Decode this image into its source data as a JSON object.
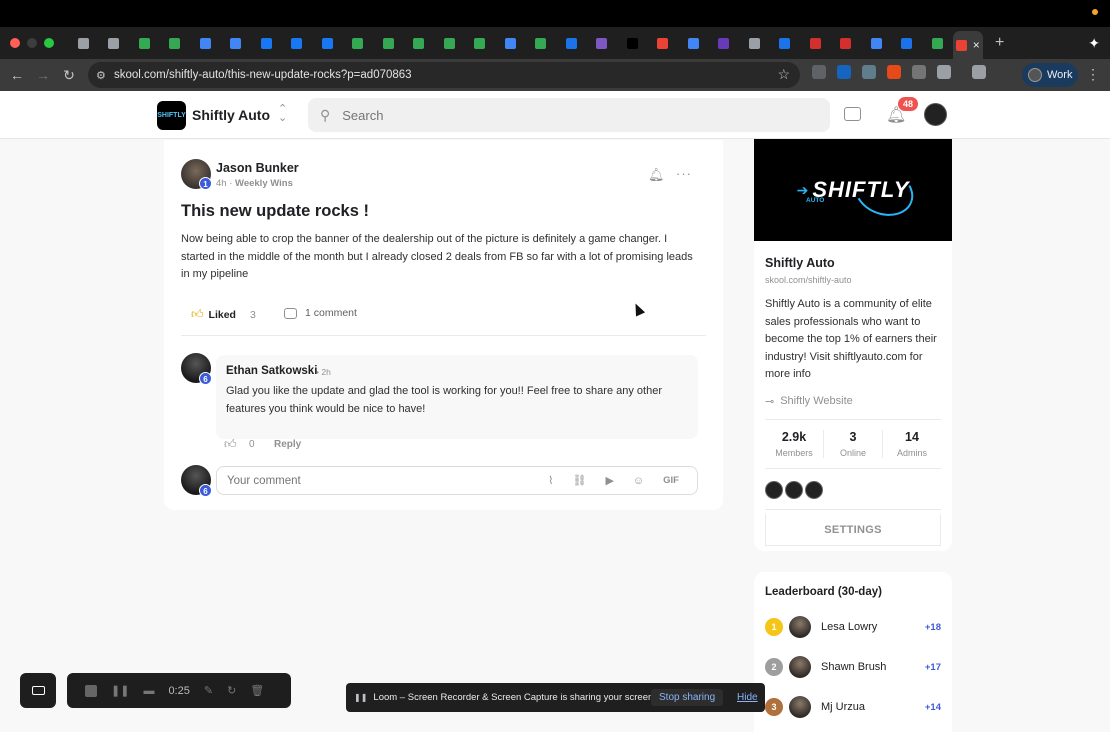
{
  "browser": {
    "url": "skool.com/shiftly-auto/this-new-update-rocks?p=ad070863",
    "profile_label": "Work",
    "tab_favicon_colors": [
      "#9aa0a6",
      "#9aa0a6",
      "#34a853",
      "#34a853",
      "#4285f4",
      "#4285f4",
      "#1877f2",
      "#1877f2",
      "#1877f2",
      "#34a853",
      "#34a853",
      "#34a853",
      "#34a853",
      "#34a853",
      "#4285f4",
      "#34a853",
      "#1a73e8",
      "#7e57c2",
      "#000000",
      "#ea4335",
      "#4285f4",
      "#673ab7",
      "#9aa0a6",
      "#1a73e8",
      "#d32f2f",
      "#d32f2f",
      "#4285f4",
      "#1a73e8",
      "#34a853",
      "#ea4335"
    ]
  },
  "header": {
    "community_name": "Shiftly Auto",
    "logo_text": "SHIFTLY",
    "search_placeholder": "Search",
    "notification_count": "48"
  },
  "post": {
    "author": "Jason Bunker",
    "author_level": "1",
    "time": "4h",
    "category": "Weekly Wins",
    "title": "This new update rocks !",
    "body": "Now being able to crop the banner of the dealership out of the picture is definitely a game changer. I started in the middle of the month but I already closed 2 deals from FB so far with a lot of promising leads in my pipeline",
    "like_label": "Liked",
    "like_count": "3",
    "comment_label": "1 comment"
  },
  "comment": {
    "author": "Ethan Satkowski",
    "author_level": "6",
    "time": "2h",
    "text": "Glad you like the update and glad the tool is working for you!! Feel free to share any other features you think would be nice to have!",
    "like_count": "0",
    "reply_label": "Reply"
  },
  "comment_input": {
    "user_level": "6",
    "placeholder": "Your comment",
    "gif_label": "GIF"
  },
  "sidebar": {
    "banner_text": "SHIFTLY",
    "banner_sub": "AUTO",
    "name": "Shiftly Auto",
    "url": "skool.com/shiftly-auto",
    "description": "Shiftly Auto is a community of elite sales professionals who want to become the top 1% of earners their industry! Visit shiftlyauto.com for more info",
    "link_label": "Shiftly Website",
    "stats": [
      {
        "value": "2.9k",
        "label": "Members"
      },
      {
        "value": "3",
        "label": "Online"
      },
      {
        "value": "14",
        "label": "Admins"
      }
    ],
    "settings_label": "SETTINGS"
  },
  "leaderboard": {
    "title": "Leaderboard (30-day)",
    "rows": [
      {
        "rank": "1",
        "name": "Lesa Lowry",
        "points": "+18",
        "medal_color": "#f5c518"
      },
      {
        "rank": "2",
        "name": "Shawn Brush",
        "points": "+17",
        "medal_color": "#9e9e9e"
      },
      {
        "rank": "3",
        "name": "Mj Urzua",
        "points": "+14",
        "medal_color": "#b0703c"
      }
    ]
  },
  "loom": {
    "timer": "0:25",
    "share_text": "Loom – Screen Recorder & Screen Capture is sharing your screen.",
    "stop_label": "Stop sharing",
    "hide_label": "Hide"
  }
}
